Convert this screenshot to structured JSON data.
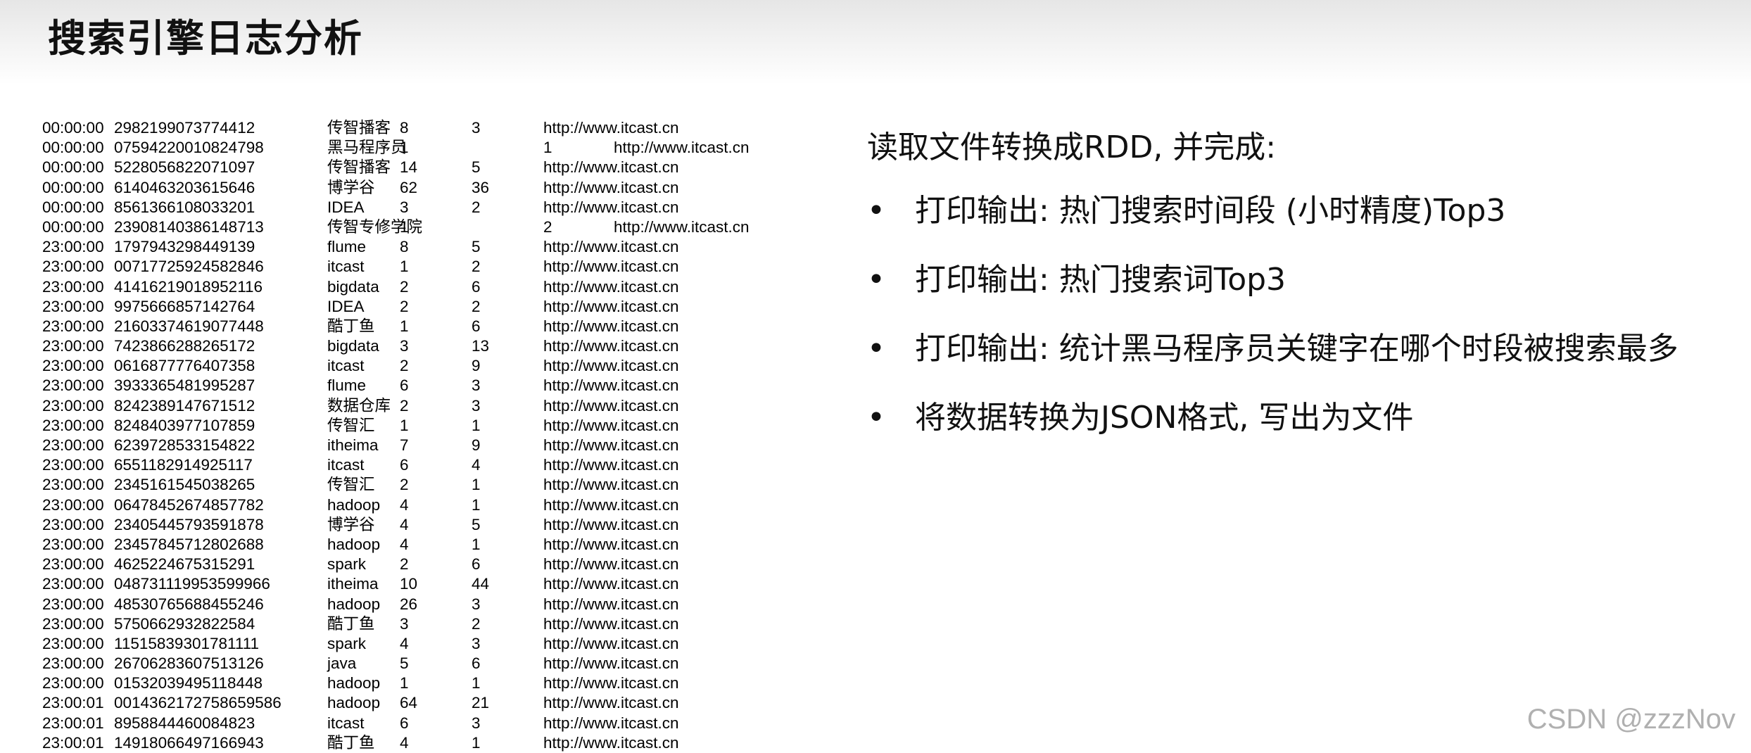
{
  "title": "搜索引擎日志分析",
  "log_rows": [
    {
      "time": "00:00:00",
      "id": "2982199073774412",
      "keyword": "传智播客",
      "rank": "8",
      "click": "3",
      "url": "http://www.itcast.cn",
      "offset": false
    },
    {
      "time": "00:00:00",
      "id": "07594220010824798",
      "keyword": "黑马程序员",
      "rank": "1",
      "click": "1",
      "url": "http://www.itcast.cn",
      "offset": true
    },
    {
      "time": "00:00:00",
      "id": "5228056822071097",
      "keyword": "传智播客",
      "rank": "14",
      "click": "5",
      "url": "http://www.itcast.cn",
      "offset": false
    },
    {
      "time": "00:00:00",
      "id": "6140463203615646",
      "keyword": "博学谷",
      "rank": "62",
      "click": "36",
      "url": "http://www.itcast.cn",
      "offset": false
    },
    {
      "time": "00:00:00",
      "id": "8561366108033201",
      "keyword": "IDEA",
      "rank": "3",
      "click": "2",
      "url": "http://www.itcast.cn",
      "offset": false
    },
    {
      "time": "00:00:00",
      "id": "23908140386148713",
      "keyword": "传智专修学院",
      "rank": "1",
      "click": "2",
      "url": "http://www.itcast.cn",
      "offset": true
    },
    {
      "time": "23:00:00",
      "id": "1797943298449139",
      "keyword": "flume",
      "rank": "8",
      "click": "5",
      "url": "http://www.itcast.cn",
      "offset": false
    },
    {
      "time": "23:00:00",
      "id": "00717725924582846",
      "keyword": "itcast",
      "rank": "1",
      "click": "2",
      "url": "http://www.itcast.cn",
      "offset": false
    },
    {
      "time": "23:00:00",
      "id": "41416219018952116",
      "keyword": "bigdata",
      "rank": "2",
      "click": "6",
      "url": "http://www.itcast.cn",
      "offset": false
    },
    {
      "time": "23:00:00",
      "id": "9975666857142764",
      "keyword": "IDEA",
      "rank": "2",
      "click": "2",
      "url": "http://www.itcast.cn",
      "offset": false
    },
    {
      "time": "23:00:00",
      "id": "21603374619077448",
      "keyword": "酷丁鱼",
      "rank": "1",
      "click": "6",
      "url": "http://www.itcast.cn",
      "offset": false
    },
    {
      "time": "23:00:00",
      "id": "7423866288265172",
      "keyword": "bigdata",
      "rank": "3",
      "click": "13",
      "url": "http://www.itcast.cn",
      "offset": false
    },
    {
      "time": "23:00:00",
      "id": "0616877776407358",
      "keyword": "itcast",
      "rank": "2",
      "click": "9",
      "url": "http://www.itcast.cn",
      "offset": false
    },
    {
      "time": "23:00:00",
      "id": "3933365481995287",
      "keyword": "flume",
      "rank": "6",
      "click": "3",
      "url": "http://www.itcast.cn",
      "offset": false
    },
    {
      "time": "23:00:00",
      "id": "8242389147671512",
      "keyword": "数据仓库",
      "rank": "2",
      "click": "3",
      "url": "http://www.itcast.cn",
      "offset": false
    },
    {
      "time": "23:00:00",
      "id": "8248403977107859",
      "keyword": "传智汇",
      "rank": "1",
      "click": "1",
      "url": "http://www.itcast.cn",
      "offset": false
    },
    {
      "time": "23:00:00",
      "id": "6239728533154822",
      "keyword": "itheima",
      "rank": "7",
      "click": "9",
      "url": "http://www.itcast.cn",
      "offset": false
    },
    {
      "time": "23:00:00",
      "id": "6551182914925117",
      "keyword": "itcast",
      "rank": "6",
      "click": "4",
      "url": "http://www.itcast.cn",
      "offset": false
    },
    {
      "time": "23:00:00",
      "id": "2345161545038265",
      "keyword": "传智汇",
      "rank": "2",
      "click": "1",
      "url": "http://www.itcast.cn",
      "offset": false
    },
    {
      "time": "23:00:00",
      "id": "06478452674857782",
      "keyword": "hadoop",
      "rank": "4",
      "click": "1",
      "url": "http://www.itcast.cn",
      "offset": false
    },
    {
      "time": "23:00:00",
      "id": "23405445793591878",
      "keyword": "博学谷",
      "rank": "4",
      "click": "5",
      "url": "http://www.itcast.cn",
      "offset": false
    },
    {
      "time": "23:00:00",
      "id": "23457845712802688",
      "keyword": "hadoop",
      "rank": "4",
      "click": "1",
      "url": "http://www.itcast.cn",
      "offset": false
    },
    {
      "time": "23:00:00",
      "id": "4625224675315291",
      "keyword": "spark",
      "rank": "2",
      "click": "6",
      "url": "http://www.itcast.cn",
      "offset": false
    },
    {
      "time": "23:00:00",
      "id": "048731119953599966",
      "keyword": "itheima",
      "rank": "10",
      "click": "44",
      "url": "http://www.itcast.cn",
      "offset": false
    },
    {
      "time": "23:00:00",
      "id": "48530765688455246",
      "keyword": "hadoop",
      "rank": "26",
      "click": "3",
      "url": "http://www.itcast.cn",
      "offset": false
    },
    {
      "time": "23:00:00",
      "id": "5750662932822584",
      "keyword": "酷丁鱼",
      "rank": "3",
      "click": "2",
      "url": "http://www.itcast.cn",
      "offset": false
    },
    {
      "time": "23:00:00",
      "id": "11515839301781111",
      "keyword": "spark",
      "rank": "4",
      "click": "3",
      "url": "http://www.itcast.cn",
      "offset": false
    },
    {
      "time": "23:00:00",
      "id": "26706283607513126",
      "keyword": "java",
      "rank": "5",
      "click": "6",
      "url": "http://www.itcast.cn",
      "offset": false
    },
    {
      "time": "23:00:00",
      "id": "01532039495118448",
      "keyword": "hadoop",
      "rank": "1",
      "click": "1",
      "url": "http://www.itcast.cn",
      "offset": false
    },
    {
      "time": "23:00:01",
      "id": "0014362172758659586",
      "keyword": "hadoop",
      "rank": "64",
      "click": "21",
      "url": "http://www.itcast.cn",
      "offset": false
    },
    {
      "time": "23:00:01",
      "id": "8958844460084823",
      "keyword": "itcast",
      "rank": "6",
      "click": "3",
      "url": "http://www.itcast.cn",
      "offset": false
    },
    {
      "time": "23:00:01",
      "id": "14918066497166943",
      "keyword": "酷丁鱼",
      "rank": "4",
      "click": "1",
      "url": "http://www.itcast.cn",
      "offset": false
    }
  ],
  "tasks": {
    "intro": "读取文件转换成RDD, 并完成:",
    "bullet": "•",
    "items": [
      "打印输出: 热门搜索时间段 (小时精度)Top3",
      "打印输出: 热门搜索词Top3",
      "打印输出: 统计黑马程序员关键字在哪个时段被搜索最多",
      "将数据转换为JSON格式, 写出为文件"
    ]
  },
  "watermark": "CSDN @zzzNov"
}
